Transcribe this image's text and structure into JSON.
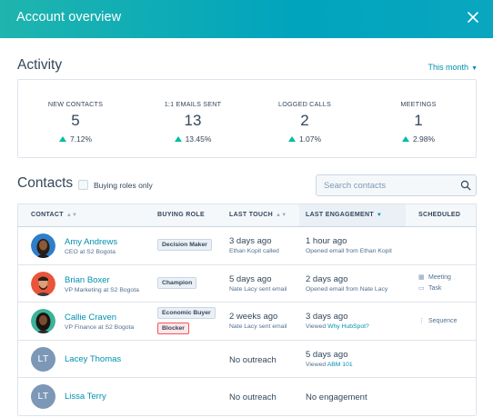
{
  "header": {
    "title": "Account overview"
  },
  "activity": {
    "title": "Activity",
    "period": "This month",
    "stats": [
      {
        "label": "NEW CONTACTS",
        "value": "5",
        "change": "7.12%"
      },
      {
        "label": "1:1 EMAILS SENT",
        "value": "13",
        "change": "13.45%"
      },
      {
        "label": "LOGGED CALLS",
        "value": "2",
        "change": "1.07%"
      },
      {
        "label": "MEETINGS",
        "value": "1",
        "change": "2.98%"
      }
    ]
  },
  "contacts": {
    "title": "Contacts",
    "filter_label": "Buying roles only",
    "search_placeholder": "Search contacts",
    "columns": [
      "CONTACT",
      "BUYING ROLE",
      "LAST TOUCH",
      "LAST ENGAGEMENT",
      "SCHEDULED"
    ],
    "rows": [
      {
        "name": "Amy Andrews",
        "subtitle": "CEO at S2 Bogota",
        "initials": "",
        "roles": [
          "Decision Maker"
        ],
        "touch_main": "3 days ago",
        "touch_sub": "Ethan Kopit called",
        "eng_main": "1 hour ago",
        "eng_sub": "Opened email from Ethan Kopit",
        "eng_link": "",
        "scheduled": []
      },
      {
        "name": "Brian Boxer",
        "subtitle": "VP Marketing at S2 Bogota",
        "initials": "",
        "roles": [
          "Champion"
        ],
        "touch_main": "5 days ago",
        "touch_sub": "Nate Lacy sent email",
        "eng_main": "2 days ago",
        "eng_sub": "Opened email from Nate Lacy",
        "eng_link": "",
        "scheduled": [
          "Meeting",
          "Task"
        ]
      },
      {
        "name": "Callie Craven",
        "subtitle": "VP Finance at S2 Bogota",
        "initials": "",
        "roles": [
          "Economic Buyer",
          "Blocker"
        ],
        "touch_main": "2 weeks ago",
        "touch_sub": "Nate Lacy sent email",
        "eng_main": "3 days ago",
        "eng_sub": "Viewed ",
        "eng_link": "Why HubSpot?",
        "scheduled": [
          "Sequence"
        ]
      },
      {
        "name": "Lacey Thomas",
        "subtitle": "",
        "initials": "LT",
        "roles": [],
        "touch_main": "No outreach",
        "touch_sub": "",
        "eng_main": "5 days ago",
        "eng_sub": "Viewed ",
        "eng_link": "ABM 101",
        "scheduled": []
      },
      {
        "name": "Lissa Terry",
        "subtitle": "",
        "initials": "LT",
        "roles": [],
        "touch_main": "No outreach",
        "touch_sub": "",
        "eng_main": "No engagement",
        "eng_sub": "",
        "eng_link": "",
        "scheduled": []
      }
    ]
  },
  "colors": {
    "accent": "#00a4bd",
    "link": "#0091ae",
    "positive": "#00bda5",
    "blocker": "#f2545b"
  },
  "icons": {
    "close": "close-icon",
    "search": "search-icon",
    "meeting": "calendar-icon",
    "task": "task-icon",
    "sequence": "sequence-icon"
  }
}
